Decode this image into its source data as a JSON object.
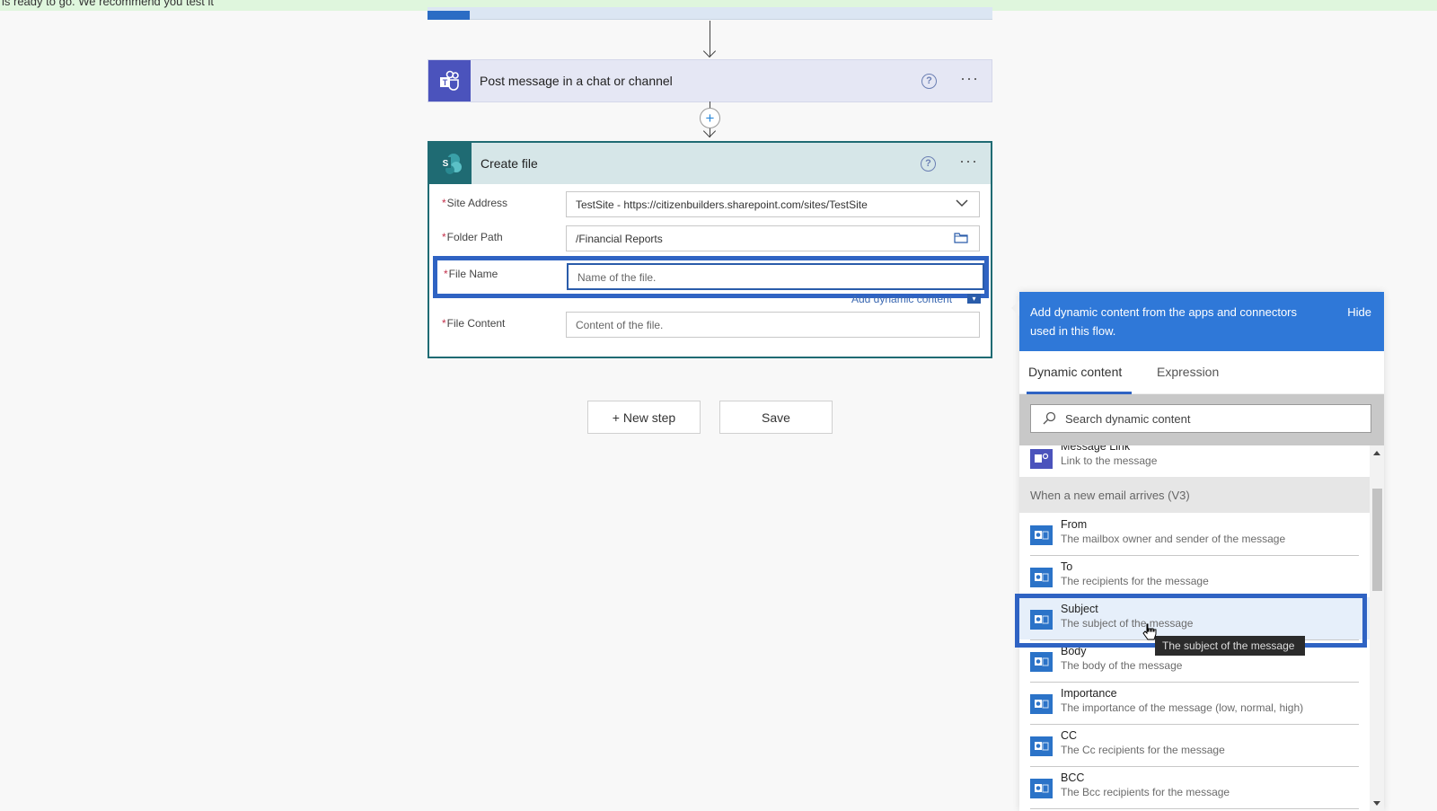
{
  "banner": {
    "text": "is ready to go. We recommend you test it"
  },
  "teams_step": {
    "title": "Post message in a chat or channel",
    "help_icon": "question-circle-icon",
    "more_icon": "ellipsis-icon"
  },
  "create_file": {
    "title": "Create file",
    "help_icon": "question-circle-icon",
    "more_icon": "ellipsis-icon",
    "fields": [
      {
        "label": "Site Address",
        "required": "*",
        "value": "TestSite - https://citizenbuilders.sharepoint.com/sites/TestSite",
        "suffix": "chevron-down-icon"
      },
      {
        "label": "Folder Path",
        "required": "*",
        "value": "/Financial Reports",
        "suffix": "folder-icon"
      },
      {
        "label": "File Name",
        "required": "*",
        "placeholder": "Name of the file."
      },
      {
        "label": "File Content",
        "required": "*",
        "placeholder": "Content of the file."
      }
    ],
    "add_dynamic_content": "Add dynamic content"
  },
  "actions": {
    "new_step": "+ New step",
    "save": "Save"
  },
  "dynamic_panel": {
    "header_text": "Add dynamic content from the apps and connectors used in this flow.",
    "hide_label": "Hide",
    "tabs": [
      {
        "label": "Dynamic content",
        "active": true
      },
      {
        "label": "Expression",
        "active": false
      }
    ],
    "search_placeholder": "Search dynamic content",
    "teams_item": {
      "title": "Message Link",
      "desc": "Link to the message"
    },
    "section_title": "When a new email arrives (V3)",
    "items": [
      {
        "title": "From",
        "desc": "The mailbox owner and sender of the message"
      },
      {
        "title": "To",
        "desc": "The recipients for the message"
      },
      {
        "title": "Subject",
        "desc": "The subject of the message",
        "selected": true
      },
      {
        "title": "Body",
        "desc": "The body of the message"
      },
      {
        "title": "Importance",
        "desc": "The importance of the message (low, normal, high)"
      },
      {
        "title": "CC",
        "desc": "The Cc recipients for the message"
      },
      {
        "title": "BCC",
        "desc": "The Bcc recipients for the message"
      }
    ],
    "tooltip": "The subject of the message"
  },
  "colors": {
    "teams": "#4b53bc",
    "sharepoint": "#1f6b73",
    "outlook": "#2b73c8",
    "accent": "#2f63c3",
    "panel_header": "#2f78d8"
  }
}
